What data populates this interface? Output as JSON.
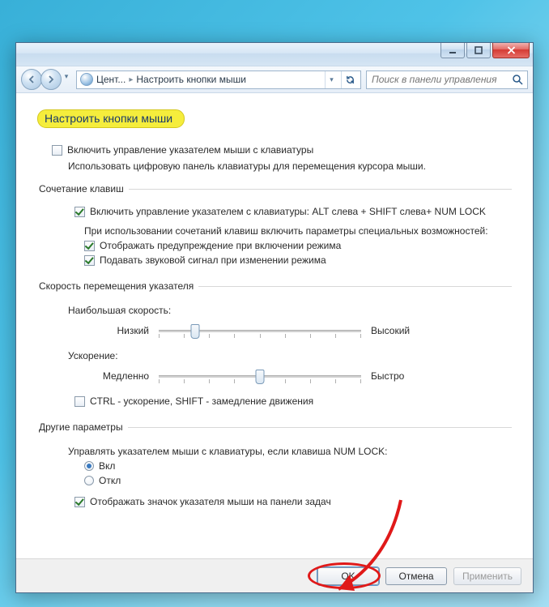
{
  "breadcrumb": {
    "item1": "Цент...",
    "item2": "Настроить кнопки мыши"
  },
  "search": {
    "placeholder": "Поиск в панели управления"
  },
  "page": {
    "title": "Настроить кнопки мыши"
  },
  "main": {
    "enable_mouse_keys": "Включить управление указателем мыши с клавиатуры",
    "enable_mouse_keys_desc": "Использовать цифровую панель клавиатуры для перемещения курсора мыши."
  },
  "shortcut_group": {
    "legend": "Сочетание клавиш",
    "enable_shortcut": "Включить управление указателем с клавиатуры: ALT слева + SHIFT слева+ NUM LOCK",
    "sub_desc": "При использовании сочетаний клавиш включить параметры специальных возможностей:",
    "show_warning": "Отображать предупреждение при включении режима",
    "play_sound": "Подавать звуковой сигнал при изменении режима"
  },
  "speed_group": {
    "legend": "Скорость перемещения указателя",
    "max_speed_label": "Наибольшая скорость:",
    "max_low": "Низкий",
    "max_high": "Высокий",
    "accel_label": "Ускорение:",
    "accel_low": "Медленно",
    "accel_high": "Быстро",
    "ctrl_shift": "CTRL - ускорение, SHIFT - замедление движения"
  },
  "other_group": {
    "legend": "Другие параметры",
    "numlock_label": "Управлять указателем мыши с клавиатуры, если клавиша NUM LOCK:",
    "on": "Вкл",
    "off": "Откл",
    "show_icon": "Отображать значок указателя мыши на панели задач"
  },
  "buttons": {
    "ok": "OK",
    "cancel": "Отмена",
    "apply": "Применить"
  },
  "sliders": {
    "max_speed_pos_pct": 18,
    "accel_pos_pct": 50
  },
  "colors": {
    "accent_annotation": "#e01919",
    "title_highlight": "#f5ed3c"
  }
}
